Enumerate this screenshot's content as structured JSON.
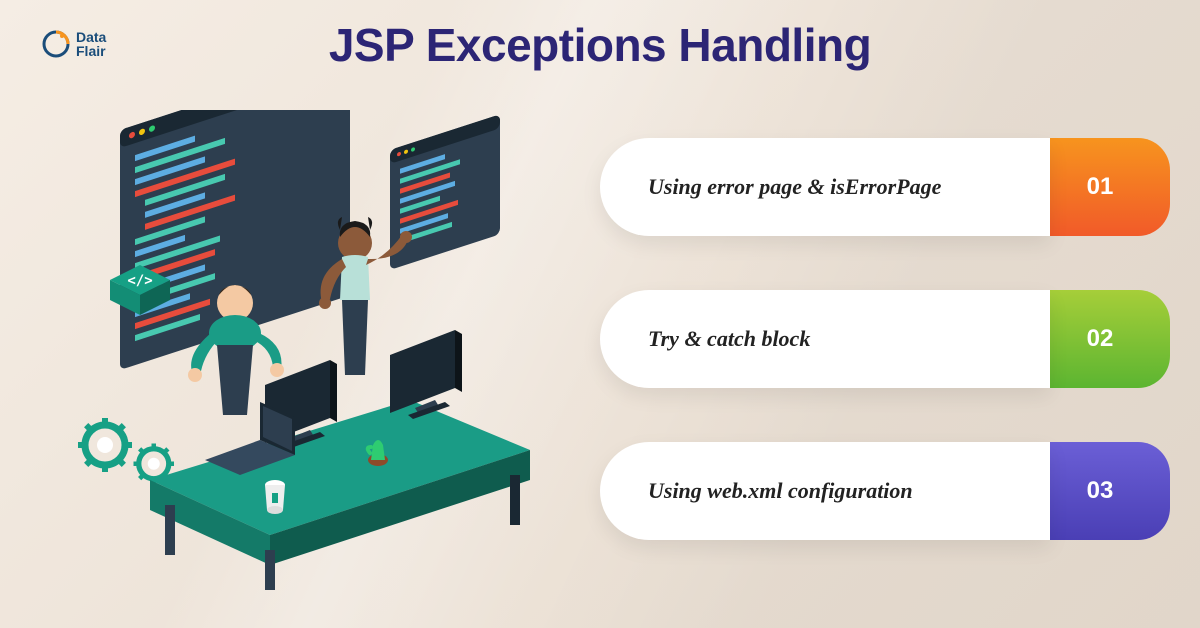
{
  "logo": {
    "text1": "Data",
    "text2": "Flair"
  },
  "title": "JSP Exceptions Handling",
  "items": [
    {
      "label": "Using error page & isErrorPage",
      "num": "01"
    },
    {
      "label": "Try & catch block",
      "num": "02"
    },
    {
      "label": "Using web.xml configuration",
      "num": "03"
    }
  ],
  "colors": {
    "title": "#2c2575",
    "item1": "#f7941e",
    "item2": "#a6ce39",
    "item3": "#6b5fd6"
  }
}
